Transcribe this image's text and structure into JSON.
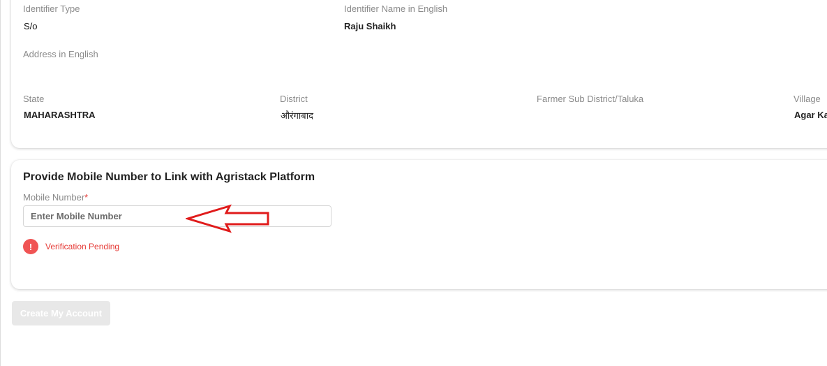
{
  "details": {
    "identifier_type_label": "Identifier Type",
    "identifier_type_value": "S/o",
    "identifier_name_label": "Identifier Name in English",
    "identifier_name_value": "Raju Shaikh",
    "address_label": "Address in English",
    "address_value": "",
    "state_label": "State",
    "state_value": "MAHARASHTRA",
    "district_label": "District",
    "district_value": "औरंगाबाद",
    "sub_district_label": "Farmer Sub District/Taluka",
    "sub_district_value": "",
    "village_label": "Village",
    "village_value": "Agar Ka"
  },
  "mobile_section": {
    "title": "Provide Mobile Number to Link with Agristack Platform",
    "field_label": "Mobile Number",
    "required_marker": "*",
    "placeholder": "Enter Mobile Number",
    "value": "",
    "status_icon_glyph": "!",
    "status_icon": "alert-circle-icon",
    "status_text": "Verification Pending"
  },
  "actions": {
    "create_account_label": "Create My Account",
    "create_account_enabled": false
  },
  "annotation": {
    "icon": "red-arrow-left-icon",
    "color": "#e01b1b"
  },
  "colors": {
    "error": "#e53935",
    "status_icon_bg": "#f05454",
    "disabled_button_bg": "#e8e8e8"
  }
}
